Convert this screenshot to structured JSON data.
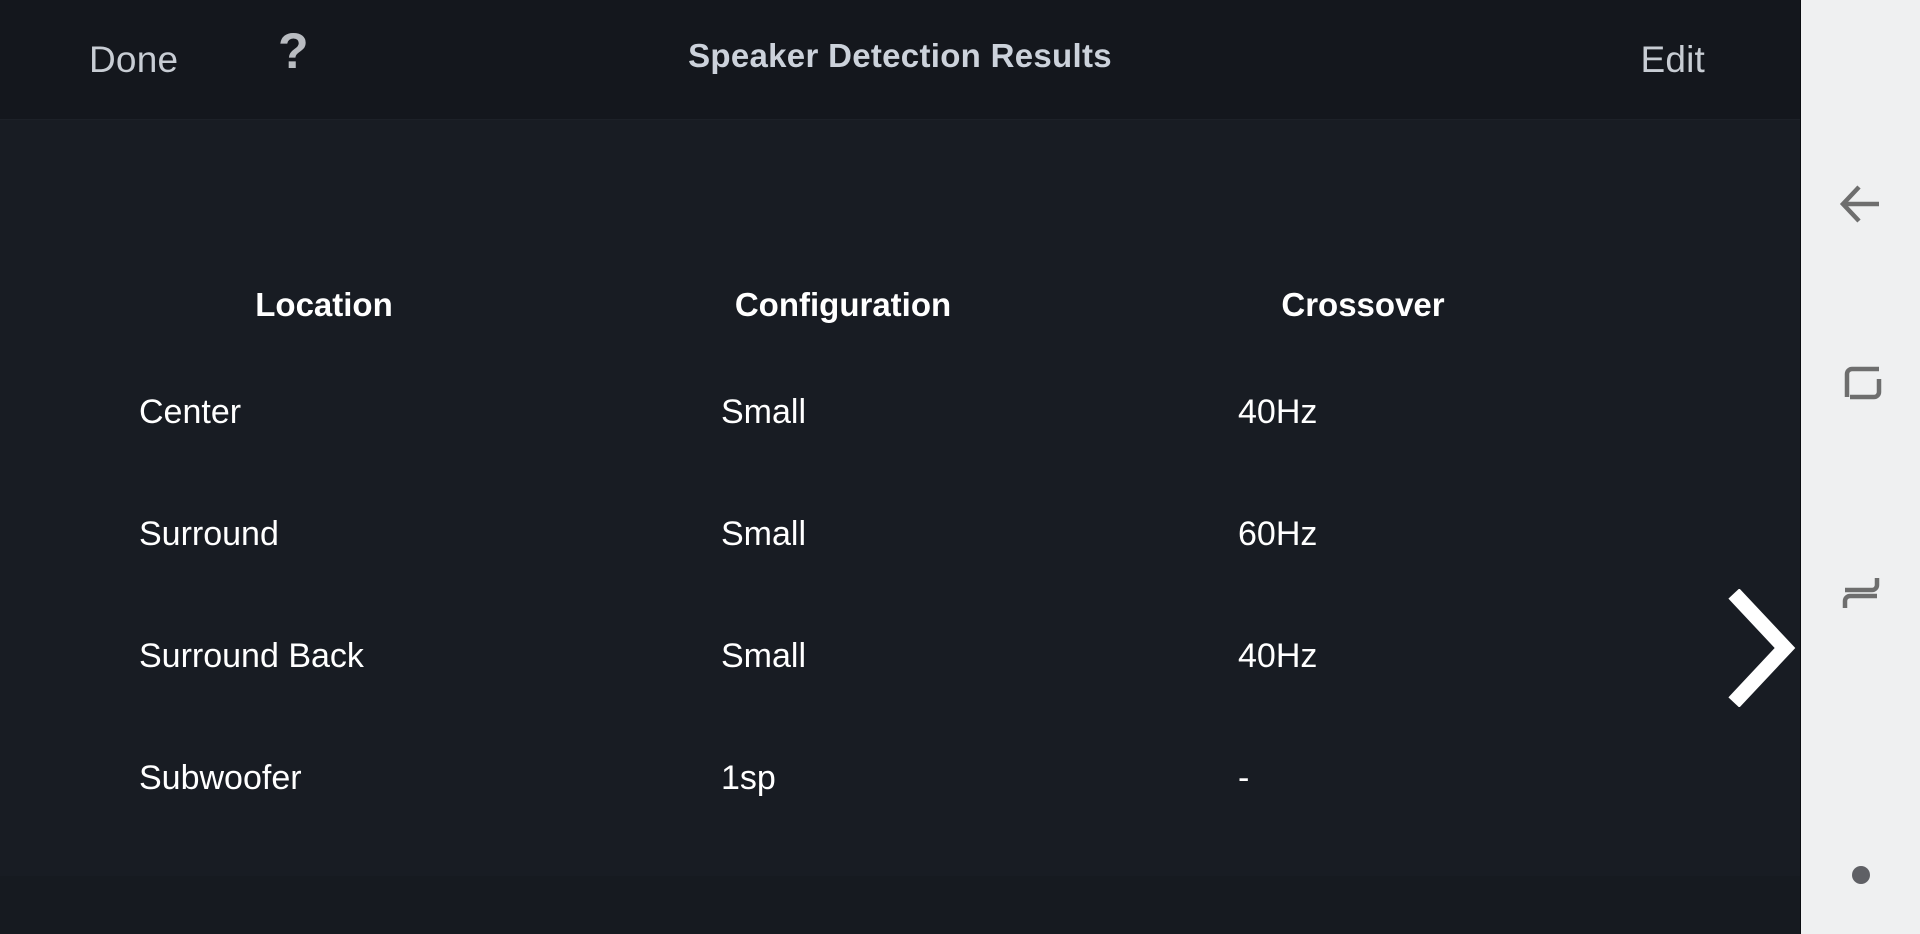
{
  "header": {
    "done_label": "Done",
    "help_icon": "question-mark-icon",
    "help_label": "?",
    "title": "Speaker Detection Results",
    "edit_label": "Edit"
  },
  "table": {
    "columns": [
      "Location",
      "Configuration",
      "Crossover"
    ],
    "rows": [
      {
        "location": "Center",
        "configuration": "Small",
        "crossover": "40Hz"
      },
      {
        "location": "Surround",
        "configuration": "Small",
        "crossover": "60Hz"
      },
      {
        "location": "Surround Back",
        "configuration": "Small",
        "crossover": "40Hz"
      },
      {
        "location": "Subwoofer",
        "configuration": "1sp",
        "crossover": "-"
      }
    ]
  },
  "pagination": {
    "next_icon": "chevron-right-icon"
  },
  "navbar": {
    "back_icon": "back-arrow-icon",
    "home_icon": "home-square-icon",
    "recents_icon": "recents-icon",
    "indicator_icon": "dot-indicator-icon"
  },
  "colors": {
    "background": "#181c23",
    "titlebar": "#14171d",
    "text_primary": "#ffffff",
    "text_secondary": "#c8cdd4",
    "navbar_background": "#eff0f1",
    "navbar_icon": "#6e6e6e"
  }
}
